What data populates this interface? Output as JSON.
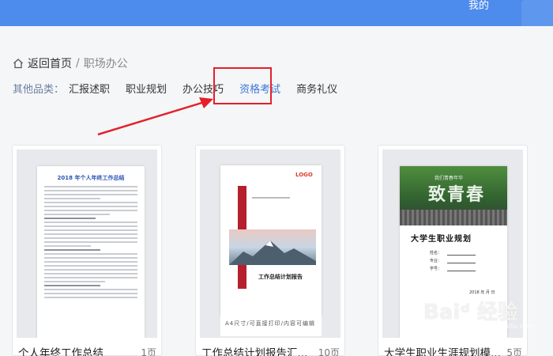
{
  "header": {
    "me_label": "我的"
  },
  "breadcrumb": {
    "home_label": "返回首页",
    "separator": "/",
    "current": "职场办公"
  },
  "categories": {
    "label": "其他品类：",
    "items": [
      {
        "label": "汇报述职",
        "active": false
      },
      {
        "label": "职业规划",
        "active": false
      },
      {
        "label": "办公技巧",
        "active": false
      },
      {
        "label": "资格考试",
        "active": true
      },
      {
        "label": "商务礼仪",
        "active": false
      }
    ]
  },
  "cards": [
    {
      "title": "个人年终工作总结",
      "pages": "1页",
      "doc_title": "2018 年个人年终工作总结"
    },
    {
      "title": "工作总结计划报告汇...",
      "pages": "10页",
      "doc_title": "工作总结计划报告",
      "caption": "A4尺寸/可直接打印/内容可编辑",
      "logo": "LOGO"
    },
    {
      "title": "大学生职业生涯规划模...",
      "pages": "5页",
      "doc_title": "大学生职业规划",
      "banner_big": "致青春",
      "banner_small": "我们青春年华",
      "fields": [
        "姓名：",
        "专业：",
        "学号："
      ],
      "date": "2018 年 月 日"
    }
  ],
  "watermark": {
    "text": "Baiᵈ 经验",
    "sub": "jingyan.baidu.com"
  },
  "colors": {
    "topbar": "#4d8bec",
    "active_category": "#3f78d6",
    "highlight": "#e3202a"
  }
}
